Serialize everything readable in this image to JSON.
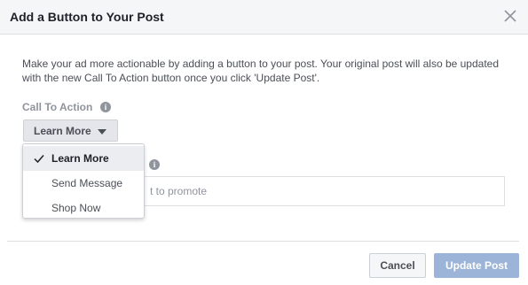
{
  "dialog": {
    "title": "Add a Button to Your Post",
    "description": "Make your ad more actionable by adding a button to your post. Your original post will also be updated with the new Call To Action button once you click 'Update Post'."
  },
  "cta": {
    "label": "Call To Action",
    "selected": "Learn More",
    "options": [
      "Learn More",
      "Send Message",
      "Shop Now"
    ]
  },
  "url_field": {
    "placeholder_fragment": "t to promote"
  },
  "footer": {
    "cancel_label": "Cancel",
    "update_label": "Update Post"
  },
  "colors": {
    "header_bg": "#f5f6f7",
    "update_button_disabled": "#9cb4d8",
    "muted_text": "#90949c"
  }
}
